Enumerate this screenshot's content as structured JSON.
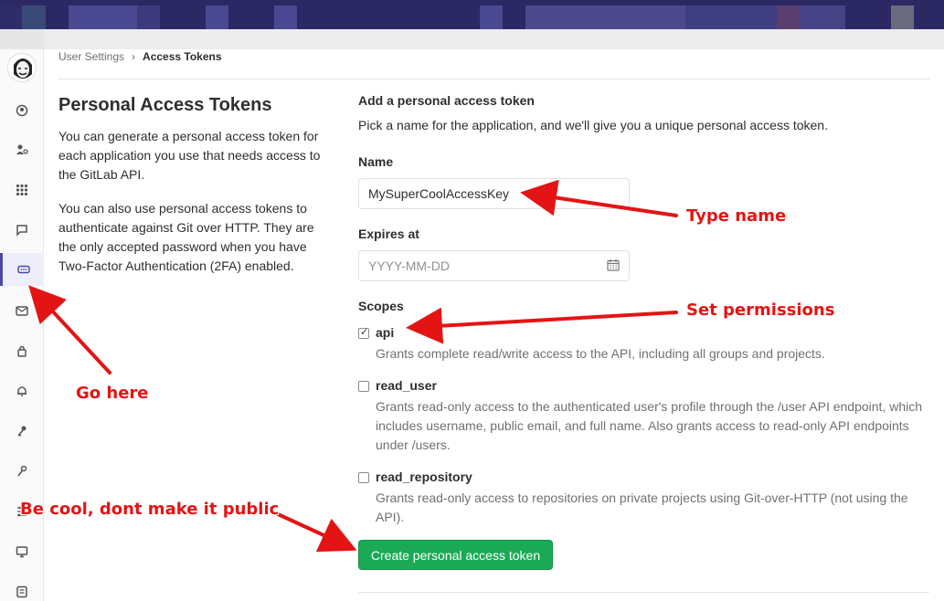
{
  "breadcrumb": {
    "parent": "User Settings",
    "separator": "›",
    "current": "Access Tokens"
  },
  "intro": {
    "title": "Personal Access Tokens",
    "p1": "You can generate a personal access token for each application you use that needs access to the GitLab API.",
    "p2": "You can also use personal access tokens to authenticate against Git over HTTP. They are the only accepted password when you have Two-Factor Authentication (2FA) enabled."
  },
  "form": {
    "title": "Add a personal access token",
    "help": "Pick a name for the application, and we'll give you a unique personal access token.",
    "name_label": "Name",
    "name_value": "MySuperCoolAccessKey",
    "expires_label": "Expires at",
    "expires_placeholder": "YYYY-MM-DD",
    "scopes_label": "Scopes",
    "scopes": [
      {
        "name": "api",
        "checked": true,
        "desc": "Grants complete read/write access to the API, including all groups and projects."
      },
      {
        "name": "read_user",
        "checked": false,
        "desc": "Grants read-only access to the authenticated user's profile through the /user API endpoint, which includes username, public email, and full name. Also grants access to read-only API endpoints under /users."
      },
      {
        "name": "read_repository",
        "checked": false,
        "desc": "Grants read-only access to repositories on private projects using Git-over-HTTP (not using the API)."
      }
    ],
    "submit_label": "Create personal access token"
  },
  "sidebar": {
    "icons": [
      "profile-icon",
      "account-icon",
      "applications-icon",
      "chat-icon",
      "access-tokens-icon",
      "emails-icon",
      "password-icon",
      "notifications-icon",
      "ssh-keys-icon",
      "gpg-keys-icon",
      "preferences-icon",
      "sessions-icon",
      "audit-log-icon"
    ],
    "active": "access-tokens-icon"
  },
  "annotations": {
    "type_name": "Type name",
    "set_permissions": "Set permissions",
    "go_here": "Go here",
    "be_cool": "Be cool, dont make it public"
  },
  "colors": {
    "topbar": "#2b2864",
    "create_button": "#1aaa55",
    "annotation": "#e41414",
    "sidebar_active": "#4b4ba3"
  }
}
